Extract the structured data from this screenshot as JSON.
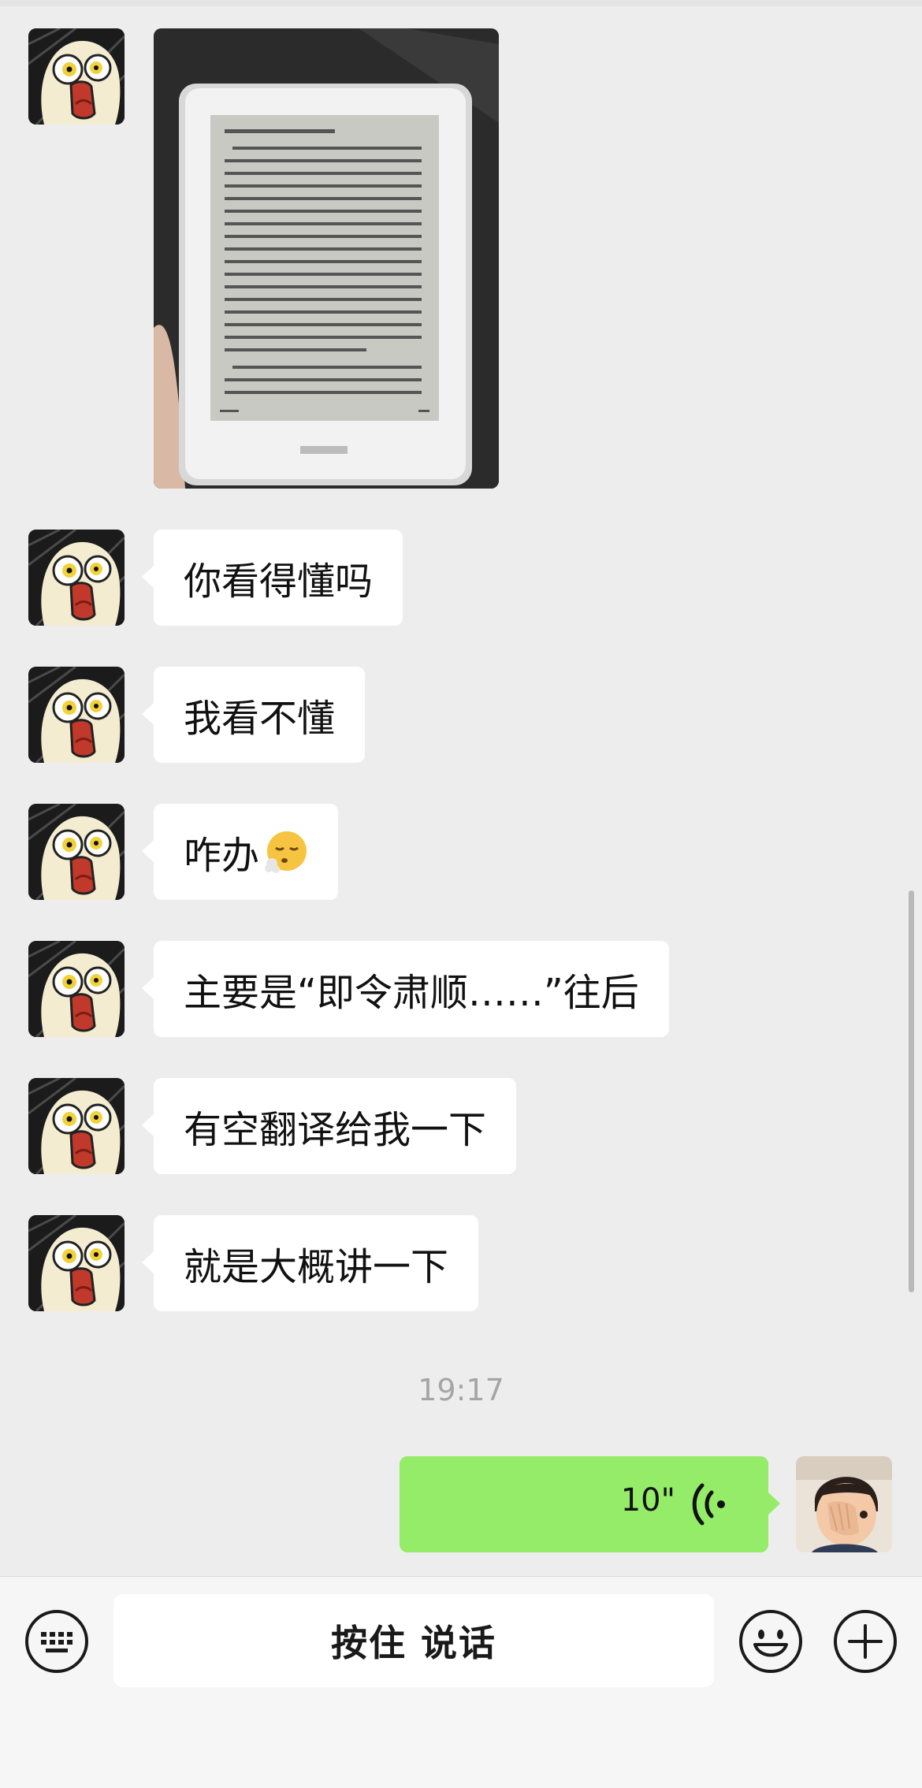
{
  "chat": {
    "messages": [
      {
        "type": "image",
        "from": "other"
      },
      {
        "type": "text",
        "from": "other",
        "text": "你看得懂吗"
      },
      {
        "type": "text",
        "from": "other",
        "text": "我看不懂"
      },
      {
        "type": "text",
        "from": "other",
        "text": "咋办",
        "emoji": "face-exhaling-emoji"
      },
      {
        "type": "text",
        "from": "other",
        "text": "主要是“即令肃顺……”往后"
      },
      {
        "type": "text",
        "from": "other",
        "text": "有空翻译给我一下"
      },
      {
        "type": "text",
        "from": "other",
        "text": "就是大概讲一下"
      }
    ],
    "timestamp": "19:17",
    "voice_message": {
      "from": "me",
      "duration": "10\"",
      "icon": "voice-wave-icon"
    }
  },
  "toolbar": {
    "left_icon": "keyboard-icon",
    "hold_to_talk_label": "按住 说话",
    "emoji_icon": "emoji-icon",
    "plus_icon": "plus-icon"
  },
  "colors": {
    "background": "#ededed",
    "bubble_received": "#ffffff",
    "bubble_sent": "#95ec69",
    "toolbar": "#f6f6f6",
    "timestamp": "#a5a5a5"
  }
}
